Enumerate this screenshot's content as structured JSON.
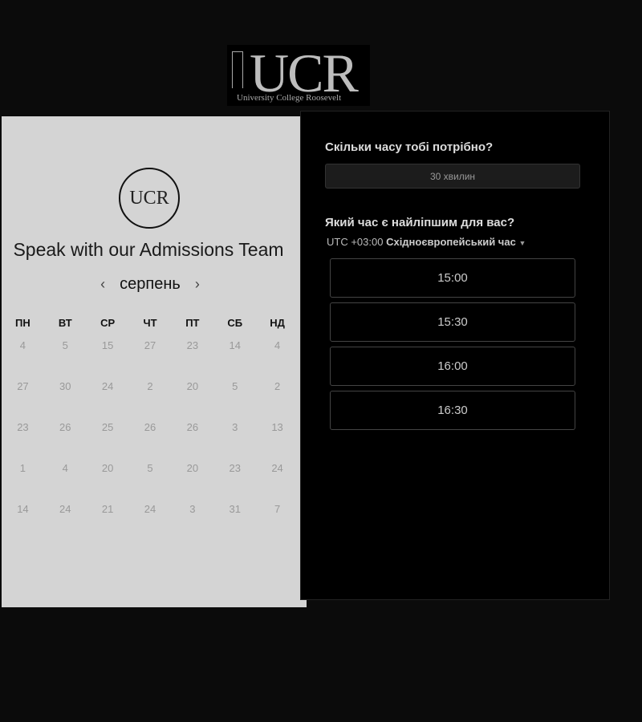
{
  "logo": {
    "text": "UCR",
    "subtitle": "University College Roosevelt"
  },
  "left": {
    "badge_text": "UCR",
    "title": "Speak with our Admissions Team",
    "month": "серпень",
    "prev_icon": "chevron-left-icon",
    "next_icon": "chevron-right-icon",
    "weekdays": [
      "ПН",
      "ВТ",
      "СР",
      "ЧТ",
      "ПТ",
      "СБ",
      "НД"
    ],
    "days": [
      [
        "4",
        "5",
        "15",
        "27",
        "23",
        "14",
        "4"
      ],
      [
        "27",
        "30",
        "24",
        "2",
        "20",
        "5",
        "2"
      ],
      [
        "23",
        "26",
        "25",
        "26",
        "26",
        "3",
        "13"
      ],
      [
        "1",
        "4",
        "20",
        "5",
        "20",
        "23",
        "24"
      ],
      [
        "14",
        "24",
        "21",
        "24",
        "3",
        "31",
        "7"
      ]
    ]
  },
  "right": {
    "duration_question": "Скільки часу тобі потрібно?",
    "duration_value": "30 хвилин",
    "time_question": "Який час є найліпшим для вас?",
    "tz_offset": "UTC +03:00",
    "tz_name": "Східноєвропейський час",
    "tz_icon": "caret-down-icon",
    "slots": [
      "15:00",
      "15:30",
      "16:00",
      "16:30"
    ]
  }
}
